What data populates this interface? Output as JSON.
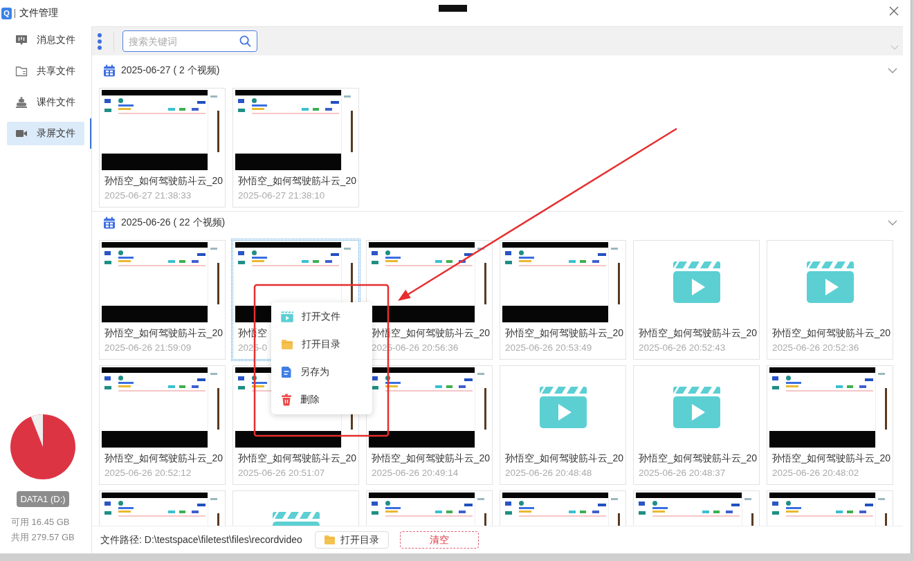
{
  "window": {
    "logo": "Q",
    "title": "文件管理"
  },
  "sidebar": {
    "items": [
      {
        "kind": "message",
        "label": "消息文件",
        "selected": false
      },
      {
        "kind": "share",
        "label": "共享文件",
        "selected": false
      },
      {
        "kind": "courseware",
        "label": "课件文件",
        "selected": false
      },
      {
        "kind": "recording",
        "label": "录屏文件",
        "selected": true
      }
    ],
    "disk": {
      "name": "DATA1 (D:)",
      "level": 0.06,
      "free": "可用 16.45 GB",
      "total": "共用 279.57 GB"
    }
  },
  "toolbar": {
    "search": {
      "placeholder": "搜索关键词"
    }
  },
  "groups": [
    {
      "title": "2025-06-27 ( 2 个视频)",
      "expanded": true,
      "videos": [
        {
          "kind": "screen",
          "title": "孙悟空_如何驾驶筋斗云_20",
          "time": "2025-06-27 21:38:33",
          "selected": false
        },
        {
          "kind": "screen",
          "title": "孙悟空_如何驾驶筋斗云_20",
          "time": "2025-06-27 21:38:10",
          "selected": false
        }
      ]
    },
    {
      "title": "2025-06-26 ( 22 个视频)",
      "expanded": true,
      "videos": [
        {
          "kind": "screen",
          "title": "孙悟空_如何驾驶筋斗云_20",
          "time": "2025-06-26 21:59:09",
          "selected": false
        },
        {
          "kind": "screen",
          "title": "孙悟空",
          "time": "2025-0",
          "selected": true
        },
        {
          "kind": "screen",
          "title": "孙悟空_如何驾驶筋斗云_20",
          "time": "2025-06-26 20:56:36",
          "selected": false
        },
        {
          "kind": "screen",
          "title": "孙悟空_如何驾驶筋斗云_20",
          "time": "2025-06-26 20:53:49",
          "selected": false
        },
        {
          "kind": "placeholder",
          "title": "孙悟空_如何驾驶筋斗云_20",
          "time": "2025-06-26 20:52:43",
          "selected": false
        },
        {
          "kind": "placeholder",
          "title": "孙悟空_如何驾驶筋斗云_20",
          "time": "2025-06-26 20:52:36",
          "selected": false
        },
        {
          "kind": "screen",
          "title": "孙悟空_如何驾驶筋斗云_20",
          "time": "2025-06-26 20:52:12",
          "selected": false
        },
        {
          "kind": "screen",
          "title": "孙悟空_如何驾驶筋斗云_20",
          "time": "2025-06-26 20:51:07",
          "selected": false
        },
        {
          "kind": "screen",
          "title": "孙悟空_如何驾驶筋斗云_20",
          "time": "2025-06-26 20:49:14",
          "selected": false
        },
        {
          "kind": "placeholder",
          "title": "孙悟空_如何驾驶筋斗云_20",
          "time": "2025-06-26 20:48:48",
          "selected": false
        },
        {
          "kind": "placeholder",
          "title": "孙悟空_如何驾驶筋斗云_20",
          "time": "2025-06-26 20:48:37",
          "selected": false
        },
        {
          "kind": "screen",
          "title": "孙悟空_如何驾驶筋斗云_20",
          "time": "2025-06-26 20:48:02",
          "selected": false
        },
        {
          "kind": "screen",
          "selected": false
        },
        {
          "kind": "placeholder",
          "selected": false
        },
        {
          "kind": "screen",
          "selected": false
        },
        {
          "kind": "screen",
          "selected": false
        },
        {
          "kind": "screen",
          "selected": false
        },
        {
          "kind": "screen",
          "selected": false
        }
      ]
    }
  ],
  "context_menu": {
    "items": [
      {
        "kind": "video",
        "label": "打开文件"
      },
      {
        "kind": "folder",
        "label": "打开目录"
      },
      {
        "kind": "document",
        "label": "另存为"
      },
      {
        "kind": "delete",
        "label": "删除"
      }
    ]
  },
  "footer": {
    "path": "文件路径: D:\\testspace\\filetest\\files\\recordvideo",
    "buttons": [
      {
        "kind": "folder",
        "label": "打开目录"
      },
      {
        "kind": "danger",
        "label": "清空"
      }
    ]
  }
}
